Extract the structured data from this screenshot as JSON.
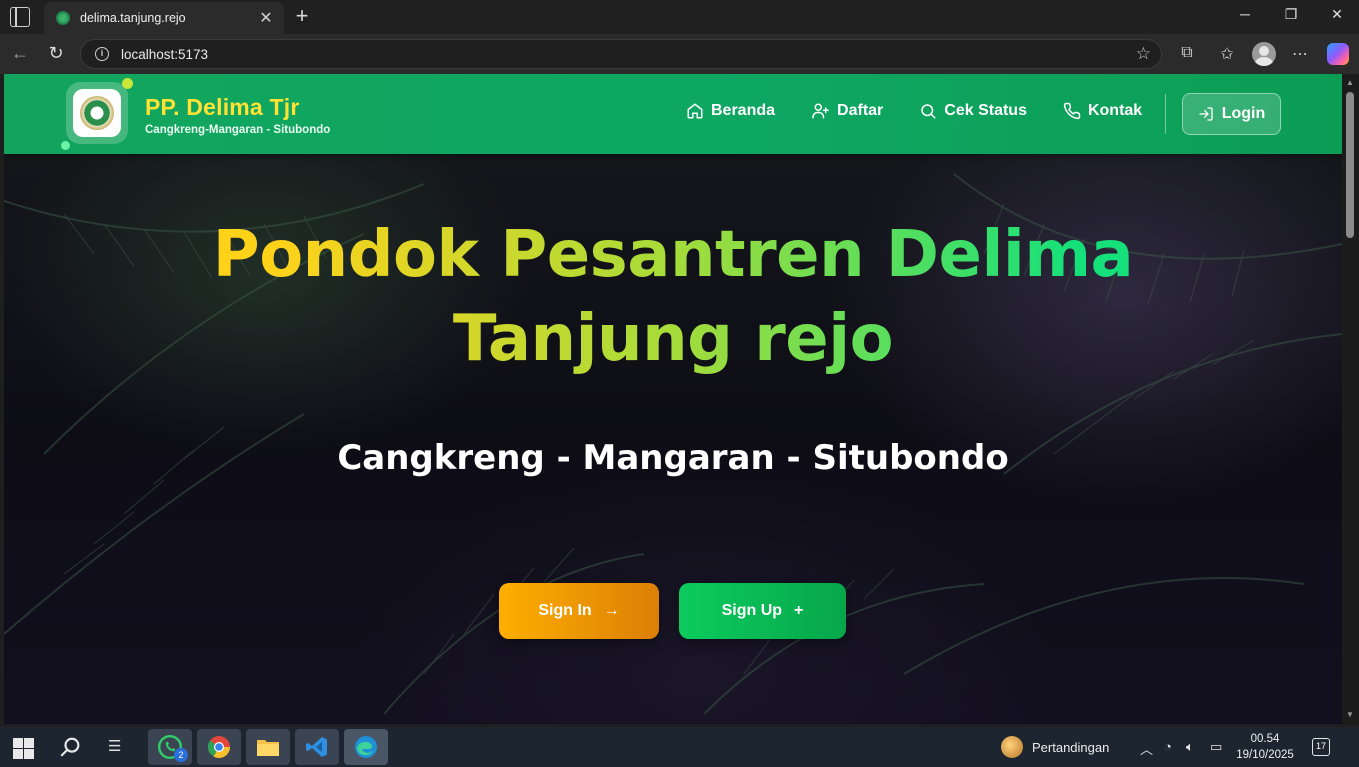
{
  "browser": {
    "tab_title": "delima.tanjung.rejo",
    "tab_close": "✕",
    "new_tab": "+",
    "url": "localhost:5173",
    "controls": {
      "minimize": "─",
      "maximize": "❐",
      "close": "✕"
    }
  },
  "site": {
    "brand_title": "PP. Delima Tjr",
    "brand_subtitle": "Cangkreng-Mangaran - Situbondo",
    "nav": [
      {
        "label": "Beranda",
        "icon": "home-icon"
      },
      {
        "label": "Daftar",
        "icon": "user-plus-icon"
      },
      {
        "label": "Cek Status",
        "icon": "search-icon"
      },
      {
        "label": "Kontak",
        "icon": "phone-icon"
      }
    ],
    "login_label": "Login",
    "accent_green": "#12a45c",
    "brand_yellow": "#ffe234"
  },
  "hero": {
    "title_line1": "Pondok Pesantren Delima",
    "title_line2": "Tanjung rejo",
    "subtitle": "Cangkreng - Mangaran - Situbondo",
    "signin_label": "Sign In",
    "signin_icon": "→",
    "signup_label": "Sign Up",
    "signup_icon": "+"
  },
  "taskbar": {
    "whatsapp_badge": "2",
    "weather_label": "Pertandingan",
    "time": "00.54",
    "date": "19/10/2025",
    "notification_count": "17"
  }
}
